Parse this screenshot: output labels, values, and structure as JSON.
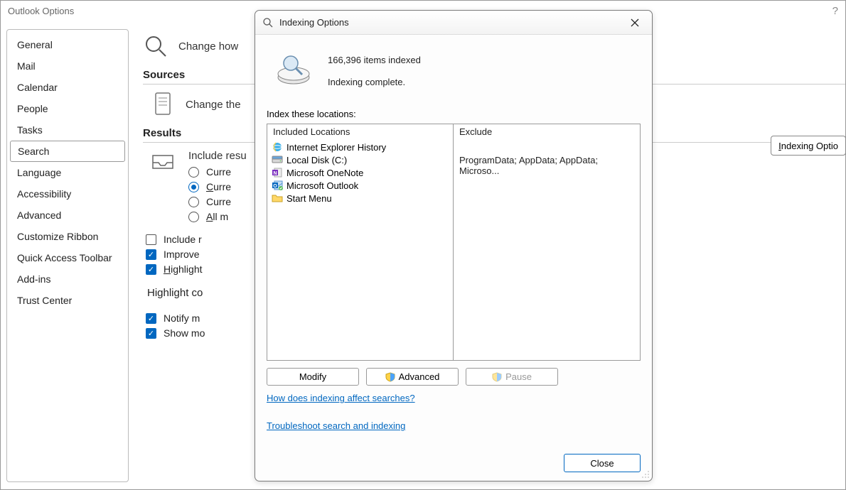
{
  "window": {
    "title": "Outlook Options",
    "help": "?"
  },
  "sidebar": {
    "items": [
      "General",
      "Mail",
      "Calendar",
      "People",
      "Tasks",
      "Search",
      "Language",
      "Accessibility",
      "Advanced",
      "Customize Ribbon",
      "Quick Access Toolbar",
      "Add-ins",
      "Trust Center"
    ],
    "selected_index": 5
  },
  "content": {
    "change_how_prefix": "Change how",
    "sources_heading": "Sources",
    "change_the_prefix": "Change the",
    "indexing_button_prefix": "I",
    "indexing_button_rest": "ndexing Optio",
    "results_heading": "Results",
    "include_results_prefix": "Include resu",
    "radios": [
      "Curre",
      "Curre",
      "Curre",
      "All m"
    ],
    "radios_selected_index": 1,
    "radio_all_underline": "A",
    "radio_all_rest": "ll m",
    "checks": [
      {
        "checked": false,
        "text": "Include r"
      },
      {
        "checked": true,
        "text": "Improve"
      },
      {
        "checked": true,
        "underline": "H",
        "text": "ighlight"
      }
    ],
    "highlight_label": "Highlight co",
    "checks2": [
      {
        "checked": true,
        "text": "Notify m"
      },
      {
        "checked": true,
        "text": "Show mo"
      }
    ]
  },
  "dialog": {
    "title": "Indexing Options",
    "items_indexed": "166,396 items indexed",
    "status": "Indexing complete.",
    "index_these": "Index these locations:",
    "col_included": "Included Locations",
    "col_exclude": "Exclude",
    "locations": [
      {
        "icon": "ie",
        "label": "Internet Explorer History"
      },
      {
        "icon": "disk",
        "label": "Local Disk (C:)"
      },
      {
        "icon": "onenote",
        "label": "Microsoft OneNote"
      },
      {
        "icon": "outlook",
        "label": "Microsoft Outlook"
      },
      {
        "icon": "folder",
        "label": "Start Menu"
      }
    ],
    "exclude_text": "ProgramData; AppData; AppData; Microso...",
    "buttons": {
      "modify": "Modify",
      "advanced": "Advanced",
      "pause": "Pause"
    },
    "link1": "How does indexing affect searches?",
    "link2": "Troubleshoot search and indexing",
    "close": "Close"
  }
}
